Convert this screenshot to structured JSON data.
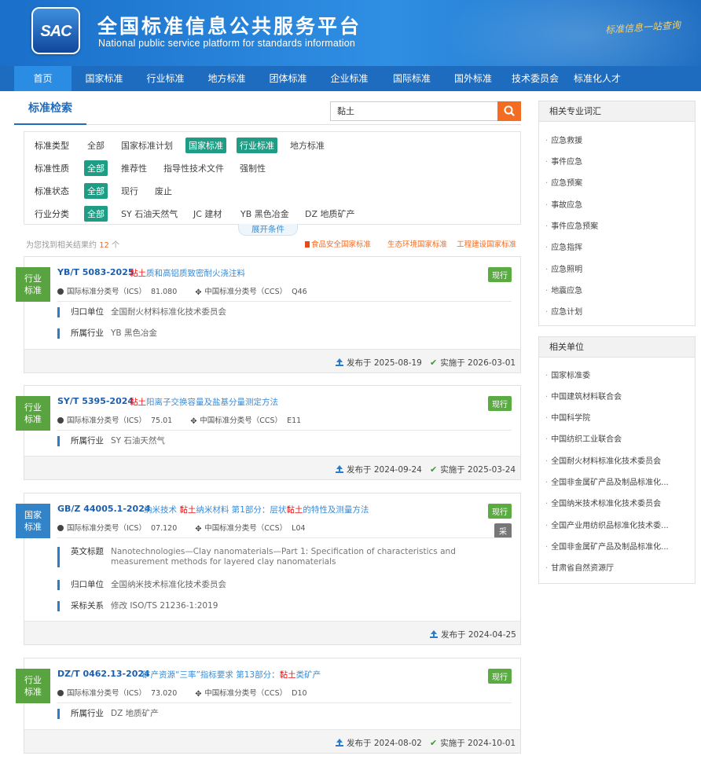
{
  "header": {
    "logo_text": "SAC",
    "title": "全国标准信息公共服务平台",
    "subtitle": "National public service platform  for standards information",
    "slogan": "标准信息一站查询"
  },
  "nav": {
    "items": [
      "首页",
      "国家标准",
      "行业标准",
      "地方标准",
      "团体标准",
      "企业标准",
      "国际标准",
      "国外标准",
      "技术委员会",
      "标准化人才"
    ],
    "active": "首页"
  },
  "search": {
    "tab_label": "标准检索",
    "query": "黏土"
  },
  "filters": {
    "rows": [
      {
        "label": "标准类型",
        "options": [
          "全部",
          "国家标准计划",
          "国家标准",
          "行业标准",
          "地方标准"
        ]
      },
      {
        "label": "标准性质",
        "options": [
          "全部",
          "推荐性",
          "指导性技术文件",
          "强制性"
        ]
      },
      {
        "label": "标准状态",
        "options": [
          "全部",
          "现行",
          "废止"
        ]
      },
      {
        "label": "行业分类",
        "options": [
          "全部",
          "SY 石油天然气",
          "JC 建材",
          "YB 黑色冶金",
          "DZ 地质矿产"
        ]
      }
    ],
    "expand_label": "展开条件"
  },
  "results_summary": {
    "prefix": "为您找到相关结果约",
    "count": "12",
    "suffix": "个"
  },
  "quick_tags": [
    "食品安全国家标准",
    "生态环境国家标准",
    "工程建设国家标准"
  ],
  "ics_label": "国际标准分类号（ICS）",
  "ccs_label": "中国标准分类号（CCS）",
  "results": [
    {
      "badge_line1": "行业",
      "badge_line2": "标准",
      "code": "YB/T 5083-2025",
      "title_hl": "黏土",
      "title_rest": "质和高铝质致密耐火浇注料",
      "title_pre": "",
      "status": "现行",
      "ics": "81.080",
      "ccs": "Q46",
      "info": [
        {
          "k": "归口单位",
          "v": "全国耐火材料标准化技术委员会"
        },
        {
          "k": "所属行业",
          "v": "YB 黑色冶金"
        }
      ],
      "published": "发布于 2025-08-19",
      "effective": "实施于 2026-03-01"
    },
    {
      "badge_line1": "行业",
      "badge_line2": "标准",
      "code": "SY/T 5395-2024",
      "title_hl": "黏土",
      "title_rest": "阳离子交换容量及盐基分量测定方法",
      "title_pre": "",
      "status": "现行",
      "ics": "75.01",
      "ccs": "E11",
      "info": [
        {
          "k": "所属行业",
          "v": "SY 石油天然气"
        }
      ],
      "published": "发布于 2024-09-24",
      "effective": "实施于 2025-03-24"
    },
    {
      "badge_line1": "国家",
      "badge_line2": "标准",
      "code": "GB/Z 44005.1-2024",
      "title_pre": "纳米技术 ",
      "title_hl": "黏土",
      "title_rest": "纳米材料 第1部分：层状",
      "title_hl2": "黏土",
      "title_tail": "的特性及测量方法",
      "status": "现行",
      "status2": "采",
      "ics": "07.120",
      "ccs": "L04",
      "info": [
        {
          "k": "英文标题",
          "v": "Nanotechnologies—Clay nanomaterials—Part 1: Specification of characteristics and measurement methods for layered clay nanomaterials"
        },
        {
          "k": "归口单位",
          "v": "全国纳米技术标准化技术委员会"
        },
        {
          "k": "采标关系",
          "v": "修改  ISO/TS 21236-1:2019"
        }
      ],
      "published": "发布于 2024-04-25"
    },
    {
      "badge_line1": "行业",
      "badge_line2": "标准",
      "code": "DZ/T 0462.13-2024",
      "title_pre": "矿产资源“三率”指标要求 第13部分：",
      "title_hl": "黏土",
      "title_rest": "类矿产",
      "status": "现行",
      "ics": "73.020",
      "ccs": "D10",
      "info": [
        {
          "k": "所属行业",
          "v": "DZ 地质矿产"
        }
      ],
      "published": "发布于 2024-08-02",
      "effective": "实施于 2024-10-01"
    }
  ],
  "sidebar": {
    "terms_title": "相关专业词汇",
    "terms": [
      "应急救援",
      "事件应急",
      "应急预案",
      "事故应急",
      "事件应急预案",
      "应急指挥",
      "应急照明",
      "地震应急",
      "应急计划"
    ],
    "units_title": "相关单位",
    "units": [
      "国家标准委",
      "中国建筑材料联合会",
      "中国科学院",
      "中国纺织工业联合会",
      "全国耐火材料标准化技术委员会",
      "全国非金属矿产品及制品标准化...",
      "全国纳米技术标准化技术委员会",
      "全国产业用纺织品标准化技术委...",
      "全国非金属矿产品及制品标准化...",
      "甘肃省自然资源厅"
    ]
  },
  "colors": {
    "brand_blue": "#1d6cbf",
    "accent_orange": "#f36c21",
    "selected_green": "#1f9d84",
    "status_green": "#5aab42"
  }
}
